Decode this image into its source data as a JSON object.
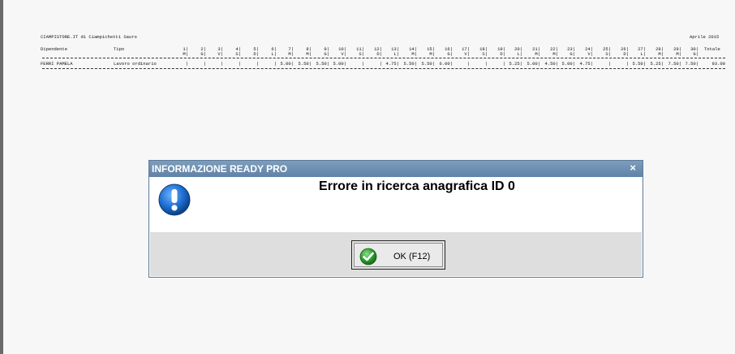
{
  "report": {
    "company": "CIAMPISTORE.IT di Ciampichetti Sauro",
    "period": "Aprile 2015",
    "col_employee": "Dipendente",
    "col_type": "Tipo",
    "col_total": "Totale",
    "days": [
      "1",
      "2",
      "3",
      "4",
      "5",
      "6",
      "7",
      "8",
      "9",
      "10",
      "11",
      "12",
      "13",
      "14",
      "15",
      "16",
      "17",
      "18",
      "19",
      "20",
      "21",
      "22",
      "23",
      "24",
      "25",
      "26",
      "27",
      "28",
      "29",
      "30"
    ],
    "weekdays": [
      "M",
      "G",
      "V",
      "S",
      "D",
      "L",
      "M",
      "M",
      "G",
      "V",
      "S",
      "D",
      "L",
      "M",
      "M",
      "G",
      "V",
      "S",
      "D",
      "L",
      "M",
      "M",
      "G",
      "V",
      "S",
      "D",
      "L",
      "M",
      "M",
      "G"
    ],
    "row": {
      "employee": "FERRI PAMELA",
      "type": "Lavoro ordinario",
      "hours": [
        "",
        "",
        "",
        "",
        "",
        "",
        "5.00",
        "5.50",
        "5.50",
        "5.00",
        "",
        "",
        "4.75",
        "5.50",
        "5.50",
        "6.00",
        "",
        "",
        "",
        "5.25",
        "5.00",
        "4.50",
        "5.00",
        "4.75",
        "",
        "",
        "5.50",
        "5.25",
        "7.50",
        "7.50"
      ],
      "total": "93.00"
    }
  },
  "dialog": {
    "title": "INFORMAZIONE READY PRO",
    "message": "Errore in ricerca anagrafica ID 0",
    "ok_label": "OK (F12)",
    "close_symbol": "×",
    "icon": "exclamation-icon",
    "ok_icon": "check-icon",
    "accent": "#5f82a6",
    "info_blue": "#1e6fd0",
    "ok_green": "#2e9e2e"
  }
}
